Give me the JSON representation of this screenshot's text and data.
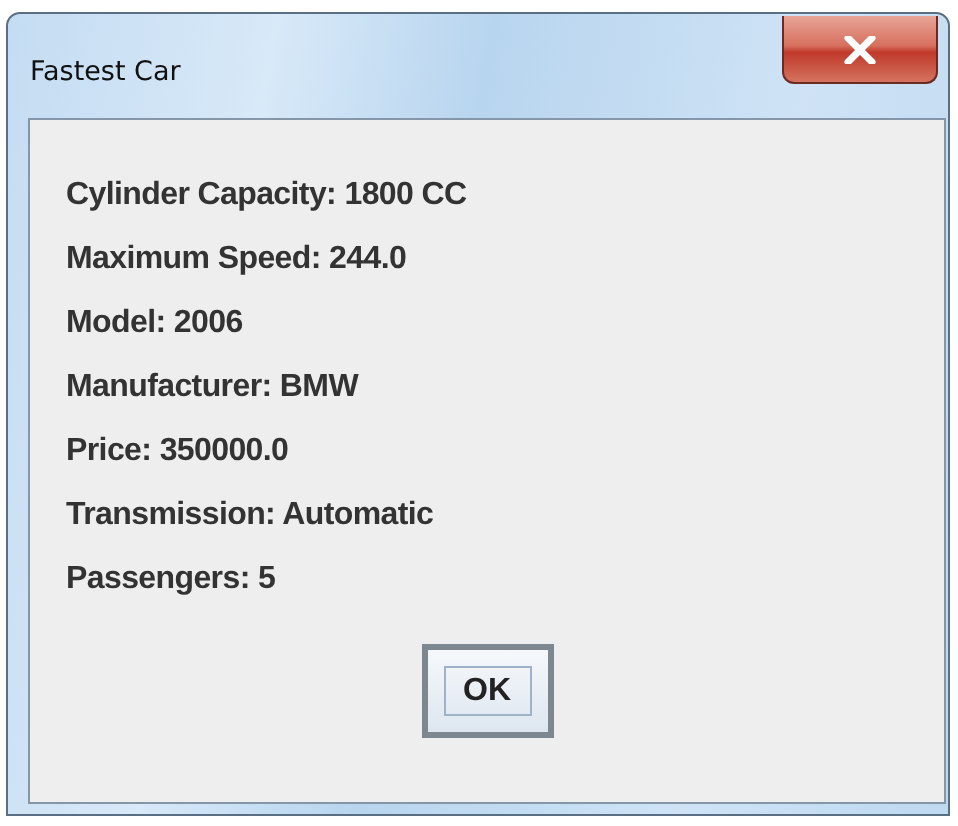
{
  "window": {
    "title": "Fastest Car"
  },
  "message_lines": [
    "Cylinder Capacity: 1800 CC",
    "Maximum Speed: 244.0",
    "Model: 2006",
    "Manufacturer: BMW",
    "Price: 350000.0",
    "Transmission: Automatic",
    "Passengers: 5"
  ],
  "buttons": [
    {
      "label": "OK",
      "focused": true
    }
  ]
}
